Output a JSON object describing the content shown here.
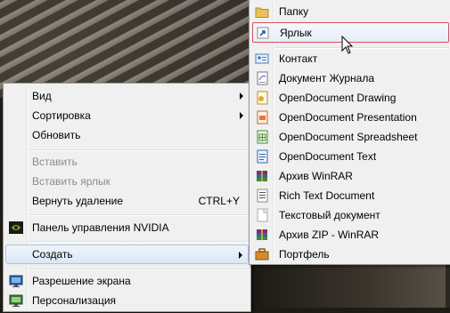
{
  "context_menu": {
    "items": [
      {
        "label": "Вид",
        "submenu": true
      },
      {
        "label": "Сортировка",
        "submenu": true
      },
      {
        "label": "Обновить"
      },
      {
        "label": "Вставить",
        "disabled": true
      },
      {
        "label": "Вставить ярлык",
        "disabled": true
      },
      {
        "label": "Вернуть удаление",
        "accel": "CTRL+Y"
      },
      {
        "label": "Панель управления NVIDIA",
        "icon": "nvidia-icon"
      },
      {
        "label": "Создать",
        "submenu": true,
        "highlighted": true
      },
      {
        "label": "Разрешение экрана",
        "icon": "display-icon"
      },
      {
        "label": "Персонализация",
        "icon": "personalize-icon"
      }
    ]
  },
  "create_submenu": {
    "items": [
      {
        "label": "Папку",
        "icon": "folder-icon"
      },
      {
        "label": "Ярлык",
        "icon": "shortcut-icon",
        "highlighted": true
      },
      {
        "label": "Контакт",
        "icon": "contact-icon"
      },
      {
        "label": "Документ Журнала",
        "icon": "journal-icon"
      },
      {
        "label": "OpenDocument Drawing",
        "icon": "od-drawing-icon"
      },
      {
        "label": "OpenDocument Presentation",
        "icon": "od-presentation-icon"
      },
      {
        "label": "OpenDocument Spreadsheet",
        "icon": "od-spreadsheet-icon"
      },
      {
        "label": "OpenDocument Text",
        "icon": "od-text-icon"
      },
      {
        "label": "Архив WinRAR",
        "icon": "winrar-icon"
      },
      {
        "label": "Rich Text Document",
        "icon": "rtf-icon"
      },
      {
        "label": "Текстовый документ",
        "icon": "text-doc-icon"
      },
      {
        "label": "Архив ZIP - WinRAR",
        "icon": "winrar-zip-icon"
      },
      {
        "label": "Портфель",
        "icon": "briefcase-icon"
      }
    ]
  },
  "colors": {
    "highlight_border": "#a9c6e8",
    "focus_border": "#d9505f",
    "menu_bg": "#f0f0f0"
  }
}
